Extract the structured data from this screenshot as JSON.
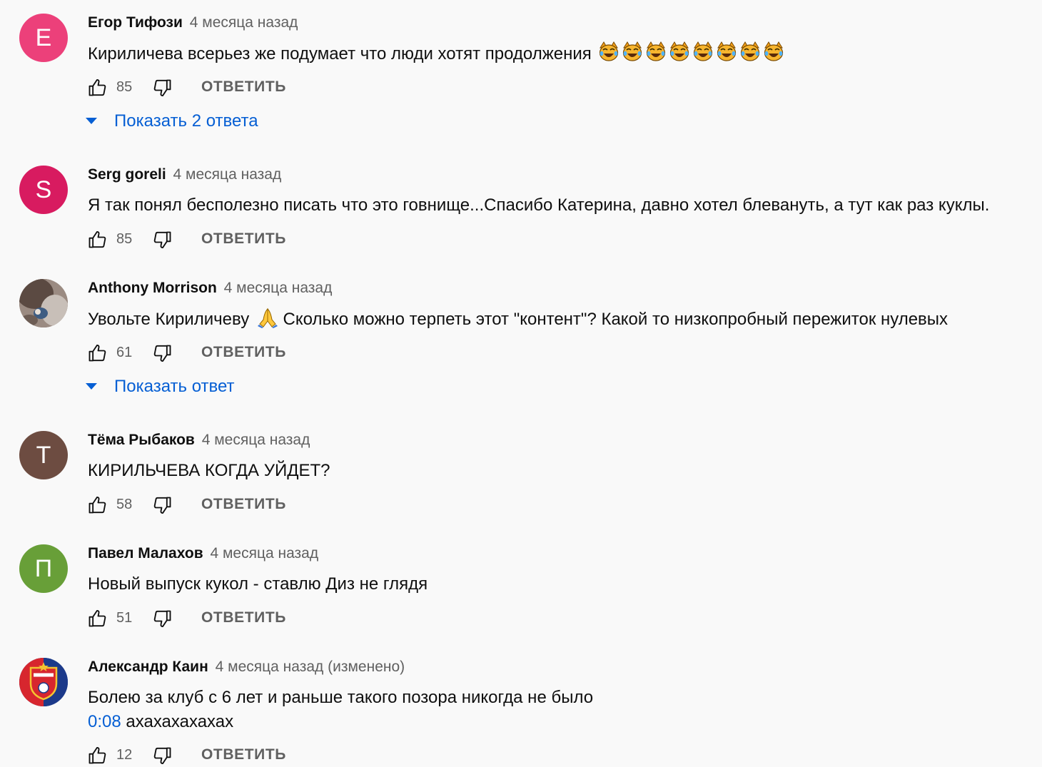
{
  "time_ago": "4 месяца назад",
  "reply_label": "ОТВЕТИТЬ",
  "colors": {
    "background": "#f9f9f9",
    "link_blue": "#065fd4",
    "secondary_text": "#606060"
  },
  "comments": [
    {
      "author": "Егор Тифози",
      "avatar_letter": "Е",
      "avatar_color": "#ec407a",
      "text": "Кириличева всерьез же подумает что люди хотят продолжения",
      "emoji": "😹😹😹😹😹😹😹😹",
      "likes": "85",
      "show_replies": "Показать 2 ответа"
    },
    {
      "author": "Serg goreli",
      "avatar_letter": "S",
      "avatar_color": "#d81b60",
      "text": "Я так понял бесполезно писать что это говнище...Спасибо Катерина, давно хотел блевануть, а тут как раз куклы.",
      "likes": "85"
    },
    {
      "author": "Anthony Morrison",
      "avatar_icon": "profile-photo",
      "text_before": "Увольте Кириличеву",
      "emoji": "🙏",
      "text_after": "Сколько можно терпеть этот \"контент\"? Какой то низкопробный пережиток нулевых",
      "likes": "61",
      "show_replies": "Показать ответ"
    },
    {
      "author": "Тёма Рыбаков",
      "avatar_letter": "Т",
      "avatar_color": "#6d4c41",
      "text": "КИРИЛЬЧЕВА КОГДА УЙДЕТ?",
      "likes": "58"
    },
    {
      "author": "Павел Малахов",
      "avatar_letter": "П",
      "avatar_color": "#689f38",
      "text": "Новый выпуск кукол - ставлю Диз не глядя",
      "likes": "51"
    },
    {
      "author": "Александр Каин",
      "avatar_icon": "cska-logo",
      "edited": "(изменено)",
      "text": "Болею за клуб с 6 лет и раньше такого позора никогда не было",
      "timestamp_link": "0:08",
      "text_line2": "ахахахахахах",
      "likes": "12"
    }
  ]
}
